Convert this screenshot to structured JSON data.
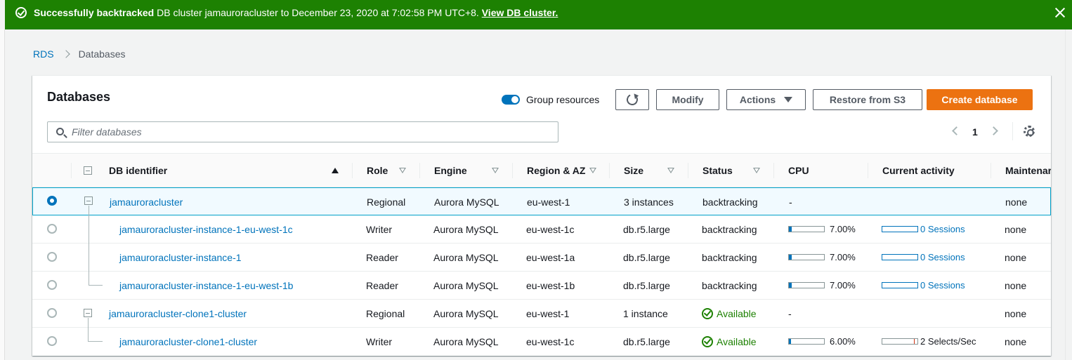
{
  "flash": {
    "title": "Successfully backtracked",
    "message": "DB cluster jamauroracluster to December 23, 2020 at 7:02:58 PM UTC+8.",
    "link": "View DB cluster."
  },
  "breadcrumb": {
    "root": "RDS",
    "current": "Databases"
  },
  "panel": {
    "title": "Databases",
    "group_label": "Group resources",
    "modify": "Modify",
    "actions": "Actions",
    "restore": "Restore from S3",
    "create": "Create database",
    "search_placeholder": "Filter databases",
    "page": "1"
  },
  "columns": {
    "id": "DB identifier",
    "role": "Role",
    "engine": "Engine",
    "region": "Region & AZ",
    "size": "Size",
    "status": "Status",
    "cpu": "CPU",
    "activity": "Current activity",
    "maint": "Maintenar"
  },
  "rows": [
    {
      "id": "jamauroracluster",
      "role": "Regional",
      "engine": "Aurora MySQL",
      "region": "eu-west-1",
      "size": "3 instances",
      "status": "backtracking",
      "cpu": "-",
      "activity": "",
      "maint": "none"
    },
    {
      "id": "jamauroracluster-instance-1-eu-west-1c",
      "role": "Writer",
      "engine": "Aurora MySQL",
      "region": "eu-west-1c",
      "size": "db.r5.large",
      "status": "backtracking",
      "cpu": "7.00%",
      "cpu_level": 0.07,
      "activity": "0 Sessions",
      "maint": "none"
    },
    {
      "id": "jamauroracluster-instance-1",
      "role": "Reader",
      "engine": "Aurora MySQL",
      "region": "eu-west-1a",
      "size": "db.r5.large",
      "status": "backtracking",
      "cpu": "7.00%",
      "cpu_level": 0.07,
      "activity": "0 Sessions",
      "maint": "none"
    },
    {
      "id": "jamauroracluster-instance-1-eu-west-1b",
      "role": "Reader",
      "engine": "Aurora MySQL",
      "region": "eu-west-1b",
      "size": "db.r5.large",
      "status": "backtracking",
      "cpu": "7.00%",
      "cpu_level": 0.07,
      "activity": "0 Sessions",
      "maint": "none"
    },
    {
      "id": "jamauroracluster-clone1-cluster",
      "role": "Regional",
      "engine": "Aurora MySQL",
      "region": "eu-west-1",
      "size": "1 instance",
      "status": "Available",
      "cpu": "-",
      "activity": "",
      "maint": "none"
    },
    {
      "id": "jamauroracluster-clone1-cluster",
      "role": "Writer",
      "engine": "Aurora MySQL",
      "region": "eu-west-1c",
      "size": "db.r5.large",
      "status": "Available",
      "cpu": "6.00%",
      "cpu_level": 0.06,
      "activity": "2 Selects/Sec",
      "maint": "none"
    }
  ],
  "colors": {
    "success": "#1d8102",
    "link": "#0073bb",
    "primary": "#ec7211"
  }
}
